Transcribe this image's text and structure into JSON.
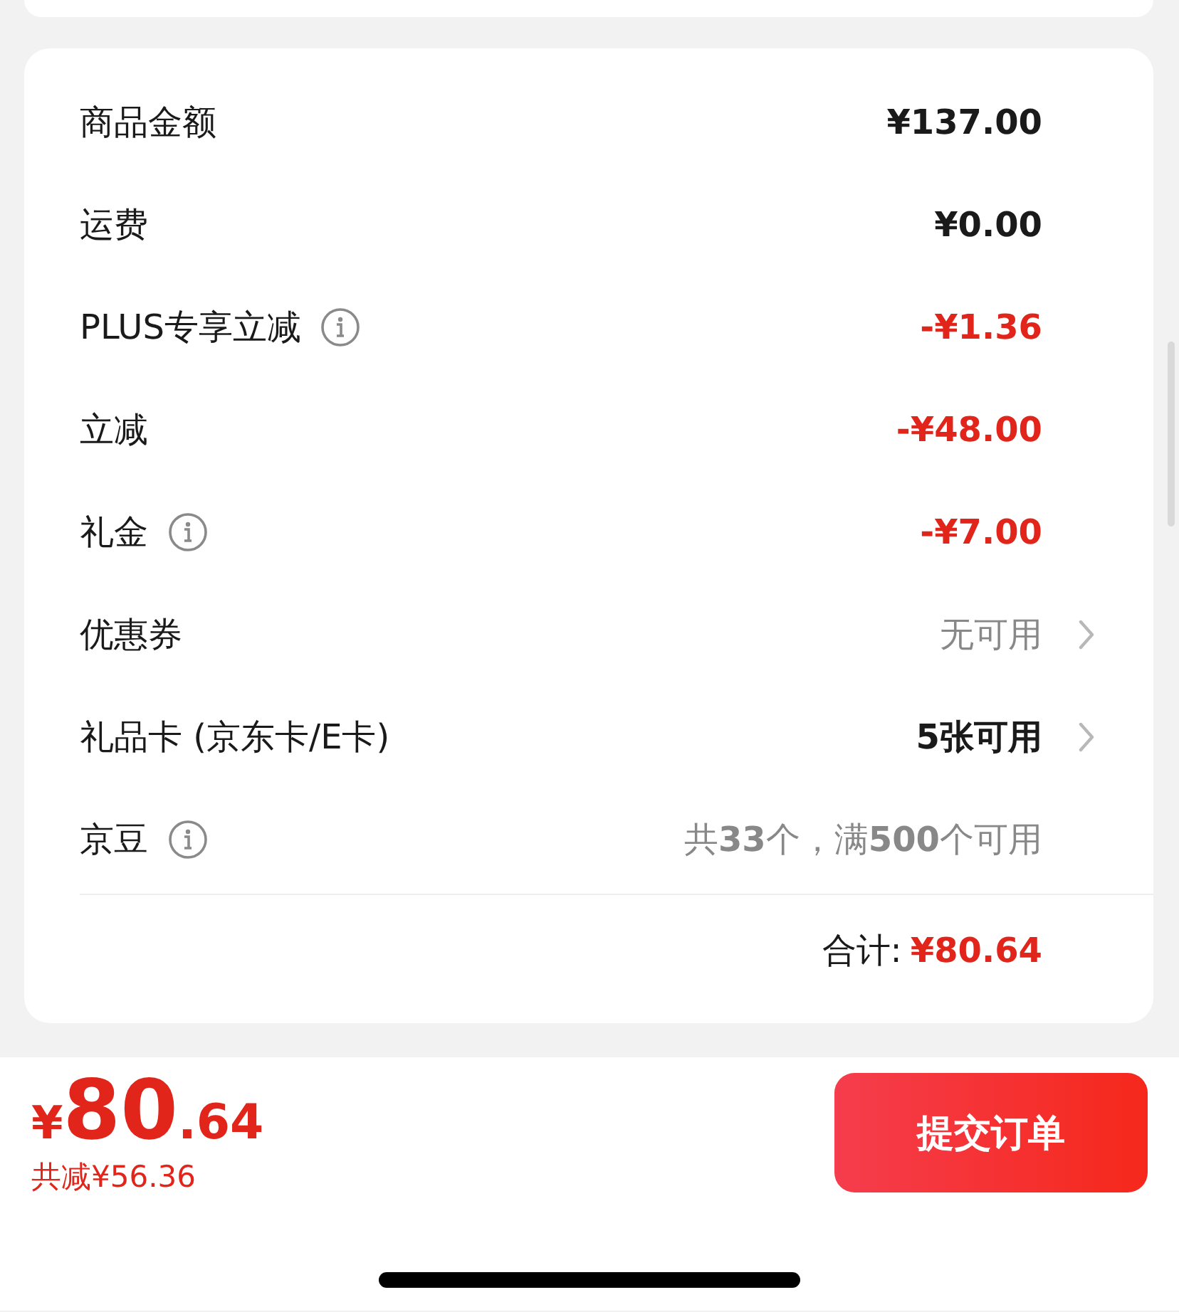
{
  "rows": [
    {
      "label": "商品金额",
      "info": false,
      "value": "¥137.00",
      "kind": "normal",
      "chevron": false
    },
    {
      "label": "运费",
      "info": false,
      "value": "¥0.00",
      "kind": "normal",
      "chevron": false
    },
    {
      "label": "PLUS专享立减",
      "info": true,
      "value": "-¥1.36",
      "kind": "discount",
      "chevron": false
    },
    {
      "label": "立减",
      "info": false,
      "value": "-¥48.00",
      "kind": "discount",
      "chevron": false
    },
    {
      "label": "礼金",
      "info": true,
      "value": "-¥7.00",
      "kind": "discount",
      "chevron": false
    },
    {
      "label": "优惠券",
      "info": false,
      "value": "无可用",
      "kind": "muted",
      "chevron": true
    },
    {
      "label": "礼品卡 (京东卡/E卡)",
      "info": false,
      "value": "5张可用",
      "kind": "normal",
      "chevron": true
    },
    {
      "label": "京豆",
      "info": true,
      "value": "共**33**个，满**500**个可用",
      "kind": "muted",
      "chevron": false
    }
  ],
  "total": {
    "label": "合计:",
    "amount": "¥80.64"
  },
  "footer": {
    "symbol": "¥",
    "integer": "80",
    "decimal": ".64",
    "saved": "共减¥56.36",
    "button": "提交订单"
  }
}
